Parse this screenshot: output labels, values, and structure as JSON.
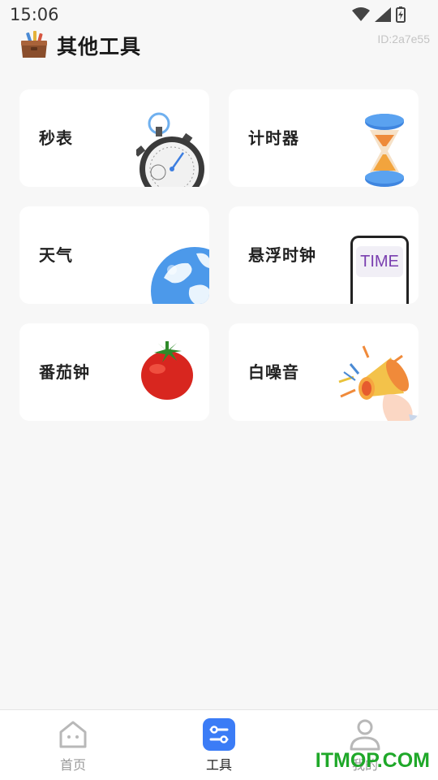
{
  "status": {
    "time": "15:06"
  },
  "header": {
    "title": "其他工具",
    "id_label": "ID:2a7e55"
  },
  "tools": [
    {
      "label": "秒表",
      "icon": "stopwatch-icon"
    },
    {
      "label": "计时器",
      "icon": "hourglass-icon"
    },
    {
      "label": "天气",
      "icon": "globe-icon"
    },
    {
      "label": "悬浮时钟",
      "icon": "phone-time-icon",
      "art_text": "TIME"
    },
    {
      "label": "番茄钟",
      "icon": "tomato-icon"
    },
    {
      "label": "白噪音",
      "icon": "megaphone-icon"
    }
  ],
  "nav": {
    "items": [
      {
        "label": "首页",
        "icon": "home-icon",
        "active": false
      },
      {
        "label": "工具",
        "icon": "tools-icon",
        "active": true
      },
      {
        "label": "我的",
        "icon": "profile-icon",
        "active": false
      }
    ]
  },
  "watermark": "ITMOP.COM",
  "colors": {
    "accent": "#3b7cf6",
    "background": "#f7f7f7",
    "watermark": "#1fa829"
  }
}
